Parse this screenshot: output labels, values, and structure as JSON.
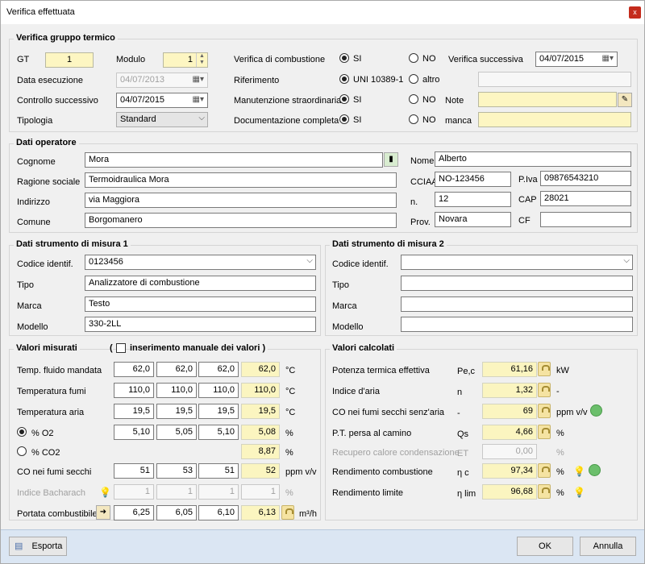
{
  "window": {
    "title": "Verifica effettuata",
    "close_glyph": "x"
  },
  "gruppo": {
    "title": "Verifica gruppo termico",
    "gt_label": "GT",
    "gt_value": "1",
    "modulo_label": "Modulo",
    "modulo_value": "1",
    "data_label": "Data esecuzione",
    "data_value": "04/07/2013",
    "controllo_label": "Controllo successivo",
    "controllo_value": "04/07/2015",
    "tipologia_label": "Tipologia",
    "tipologia_value": "Standard",
    "verifica_label": "Verifica di combustione",
    "riferimento_label": "Riferimento",
    "manutenzione_label": "Manutenzione straordinaria",
    "documentazione_label": "Documentazione completa",
    "si": "SI",
    "no": "NO",
    "uni": "UNI 10389-1",
    "altro": "altro",
    "verifica_succ_label": "Verifica successiva",
    "verifica_succ_value": "04/07/2015",
    "note_label": "Note",
    "manca_label": "manca"
  },
  "operatore": {
    "title": "Dati operatore",
    "cognome_label": "Cognome",
    "cognome_value": "Mora",
    "nome_label": "Nome",
    "nome_value": "Alberto",
    "ragione_label": "Ragione sociale",
    "ragione_value": "Termoidraulica Mora",
    "cciaa_label": "CCIAA",
    "cciaa_value": "NO-123456",
    "piva_label": "P.Iva",
    "piva_value": "09876543210",
    "indirizzo_label": "Indirizzo",
    "indirizzo_value": "via Maggiora",
    "n_label": "n.",
    "n_value": "12",
    "cap_label": "CAP",
    "cap_value": "28021",
    "comune_label": "Comune",
    "comune_value": "Borgomanero",
    "prov_label": "Prov.",
    "prov_value": "Novara",
    "cf_label": "CF",
    "cf_value": ""
  },
  "strumento1": {
    "title": "Dati strumento di misura 1",
    "codice_label": "Codice identif.",
    "codice_value": "0123456",
    "tipo_label": "Tipo",
    "tipo_value": "Analizzatore di combustione",
    "marca_label": "Marca",
    "marca_value": "Testo",
    "modello_label": "Modello",
    "modello_value": "330-2LL"
  },
  "strumento2": {
    "title": "Dati strumento di misura 2",
    "codice_label": "Codice identif.",
    "codice_value": "",
    "tipo_label": "Tipo",
    "tipo_value": "",
    "marca_label": "Marca",
    "marca_value": "",
    "modello_label": "Modello",
    "modello_value": ""
  },
  "misurati": {
    "title": "Valori misurati",
    "manual_prefix": "(",
    "manual_label": "inserimento manuale dei valori )",
    "rows": [
      {
        "label": "Temp. fluido mandata",
        "v1": "62,0",
        "v2": "62,0",
        "v3": "62,0",
        "avg": "62,0",
        "unit": "°C"
      },
      {
        "label": "Temperatura fumi",
        "v1": "110,0",
        "v2": "110,0",
        "v3": "110,0",
        "avg": "110,0",
        "unit": "°C"
      },
      {
        "label": "Temperatura aria",
        "v1": "19,5",
        "v2": "19,5",
        "v3": "19,5",
        "avg": "19,5",
        "unit": "°C"
      },
      {
        "label": "% O2",
        "v1": "5,10",
        "v2": "5,05",
        "v3": "5,10",
        "avg": "5,08",
        "unit": "%"
      },
      {
        "label": "% CO2",
        "avg": "8,87",
        "unit": "%"
      },
      {
        "label": "CO nei fumi secchi",
        "v1": "51",
        "v2": "53",
        "v3": "51",
        "avg": "52",
        "unit": "ppm v/v"
      },
      {
        "label": "Indice Bacharach",
        "v1": "1",
        "v2": "1",
        "v3": "1",
        "avg": "1",
        "unit": "%"
      },
      {
        "label": "Portata combustibile",
        "v1": "6,25",
        "v2": "6,05",
        "v3": "6,10",
        "avg": "6,13",
        "unit": "m³/h"
      }
    ]
  },
  "calcolati": {
    "title": "Valori calcolati",
    "rows": [
      {
        "label": "Potenza termica effettiva",
        "sym": "Pe,c",
        "value": "61,16",
        "unit": "kW"
      },
      {
        "label": "Indice d'aria",
        "sym": "n",
        "value": "1,32",
        "unit": "-"
      },
      {
        "label": "CO nei fumi secchi senz'aria",
        "sym": "-",
        "value": "69",
        "unit": "ppm v/v"
      },
      {
        "label": "P.T. persa al camino",
        "sym": "Qs",
        "value": "4,66",
        "unit": "%"
      },
      {
        "label": "Recupero calore condensazione",
        "sym": "ET",
        "value": "0,00",
        "unit": "%"
      },
      {
        "label": "Rendimento combustione",
        "sym": "η c",
        "value": "97,34",
        "unit": "%"
      },
      {
        "label": "Rendimento limite",
        "sym": "η lim",
        "value": "96,68",
        "unit": "%"
      }
    ]
  },
  "footer": {
    "esporta": "Esporta",
    "ok": "OK",
    "annulla": "Annulla"
  },
  "colors": {
    "yellow_field": "#fdf6c2",
    "status_green": "#6cbf6c",
    "bottom_bar": "#dbe6f3"
  }
}
